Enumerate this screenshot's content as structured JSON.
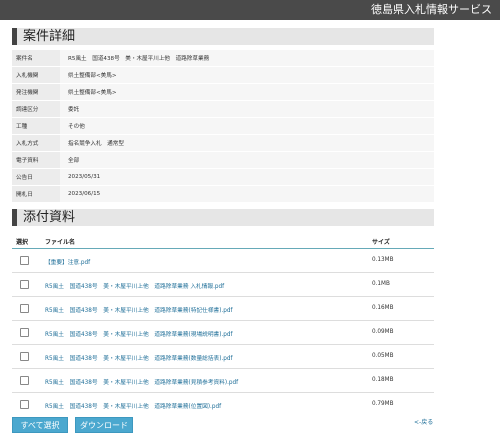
{
  "header": {
    "brand": "徳島県入札情報サービス"
  },
  "detail": {
    "title": "案件詳細",
    "rows": [
      {
        "label": "案件名",
        "value": "R5風土　国道438号　美・木屋平川上他　道路除草業務"
      },
      {
        "label": "入札機関",
        "value": "県土整備部<美馬>"
      },
      {
        "label": "発注機関",
        "value": "県土整備部<美馬>"
      },
      {
        "label": "調達区分",
        "value": "委託"
      },
      {
        "label": "工種",
        "value": "その他"
      },
      {
        "label": "入札方式",
        "value": "指名競争入札　通常型"
      },
      {
        "label": "電子資料",
        "value": "全部"
      },
      {
        "label": "公告日",
        "value": "2023/05/31"
      },
      {
        "label": "開札日",
        "value": "2023/06/15"
      }
    ]
  },
  "files": {
    "title": "添付資料",
    "col_select": "選択",
    "col_name": "ファイル名",
    "col_size": "サイズ",
    "items": [
      {
        "name": "【重要】注意.pdf",
        "size": "0.13MB"
      },
      {
        "name": "R5風土　国道438号　美・木屋平川上他　道路除草業務 入札情報.pdf",
        "size": "0.1MB"
      },
      {
        "name": "R5風土　国道438号　美・木屋平川上他　道路除草業務(特記仕様書).pdf",
        "size": "0.16MB"
      },
      {
        "name": "R5風土　国道438号　美・木屋平川上他　道路除草業務(現場説明書).pdf",
        "size": "0.09MB"
      },
      {
        "name": "R5風土　国道438号　美・木屋平川上他　道路除草業務(数量総括表).pdf",
        "size": "0.05MB"
      },
      {
        "name": "R5風土　国道438号　美・木屋平川上他　道路除草業務(見積参考資料).pdf",
        "size": "0.18MB"
      },
      {
        "name": "R5風土　国道438号　美・木屋平川上他　道路除草業務(位置図).pdf",
        "size": "0.79MB"
      }
    ]
  },
  "actions": {
    "select_all": "すべて選択",
    "download": "ダウンロード",
    "back": "<-戻る"
  }
}
